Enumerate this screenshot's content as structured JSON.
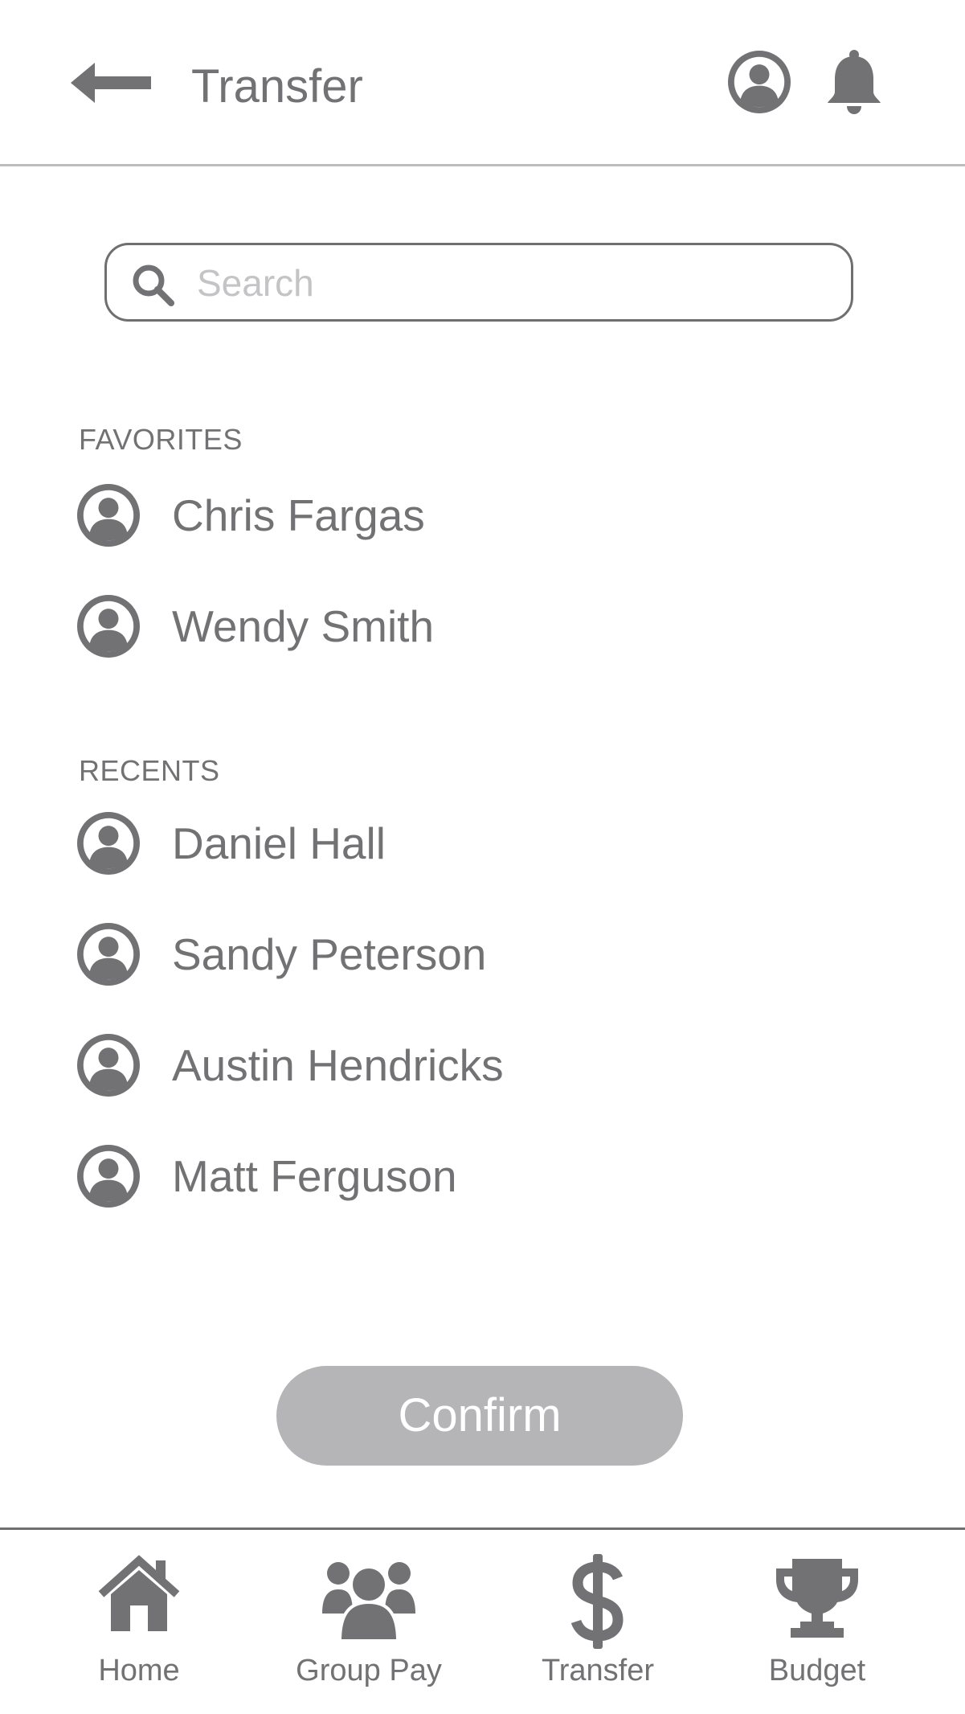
{
  "header": {
    "title": "Transfer",
    "back_icon": "arrow-left-icon",
    "profile_icon": "user-circle-icon",
    "notifications_icon": "bell-icon"
  },
  "search": {
    "placeholder": "Search",
    "value": "",
    "icon": "search-icon"
  },
  "favorites": {
    "label": "FAVORITES",
    "contacts": [
      {
        "name": "Chris Fargas",
        "icon": "user-circle-icon"
      },
      {
        "name": "Wendy Smith",
        "icon": "user-circle-icon"
      }
    ]
  },
  "recents": {
    "label": "RECENTS",
    "contacts": [
      {
        "name": "Daniel Hall",
        "icon": "user-circle-icon"
      },
      {
        "name": "Sandy Peterson",
        "icon": "user-circle-icon"
      },
      {
        "name": "Austin Hendricks",
        "icon": "user-circle-icon"
      },
      {
        "name": "Matt Ferguson",
        "icon": "user-circle-icon"
      }
    ]
  },
  "confirm": {
    "label": "Confirm"
  },
  "bottom_nav": {
    "items": [
      {
        "label": "Home",
        "icon": "home-icon"
      },
      {
        "label": "Group Pay",
        "icon": "group-icon"
      },
      {
        "label": "Transfer",
        "icon": "dollar-icon"
      },
      {
        "label": "Budget",
        "icon": "trophy-icon"
      }
    ]
  },
  "colors": {
    "icon_gray": "#727274",
    "text_gray": "#727274",
    "placeholder_gray": "#c4c4c6",
    "button_gray": "#b5b5b7",
    "divider_light": "#bdbdbf",
    "divider_dark": "#6f6f71",
    "background": "#ffffff"
  }
}
